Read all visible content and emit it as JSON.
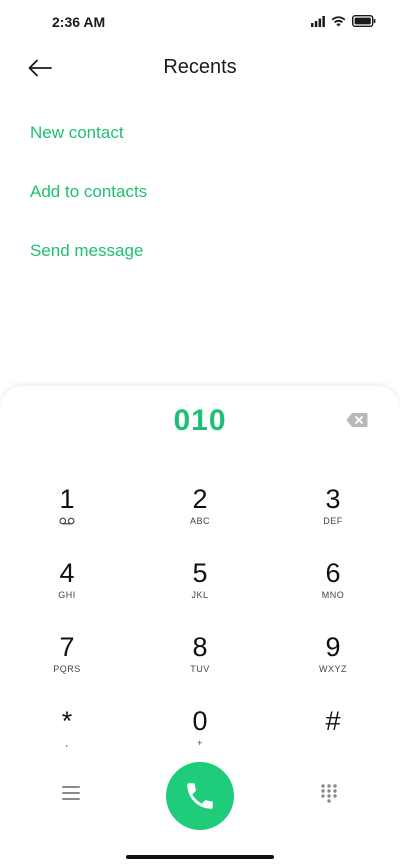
{
  "status_bar": {
    "time": "2:36 AM",
    "icons": [
      "signal-icon",
      "wifi-icon",
      "battery-icon"
    ]
  },
  "header": {
    "title": "Recents",
    "back_icon": "back-arrow-icon"
  },
  "actions": [
    {
      "label": "New contact"
    },
    {
      "label": "Add to contacts"
    },
    {
      "label": "Send message"
    }
  ],
  "dialpad": {
    "number": "010",
    "backspace_icon": "backspace-icon",
    "keys": [
      {
        "digit": "1",
        "letters": ""
      },
      {
        "digit": "2",
        "letters": "ABC"
      },
      {
        "digit": "3",
        "letters": "DEF"
      },
      {
        "digit": "4",
        "letters": "GHI"
      },
      {
        "digit": "5",
        "letters": "JKL"
      },
      {
        "digit": "6",
        "letters": "MNO"
      },
      {
        "digit": "7",
        "letters": "PQRS"
      },
      {
        "digit": "8",
        "letters": "TUV"
      },
      {
        "digit": "9",
        "letters": "WXYZ"
      },
      {
        "digit": "*",
        "letters": ","
      },
      {
        "digit": "0",
        "letters": "+"
      },
      {
        "digit": "#",
        "letters": ""
      }
    ],
    "key1_sub_icon": "voicemail-icon",
    "bottom": {
      "menu_icon": "menu-icon",
      "call_icon": "phone-icon",
      "keypad_icon": "dialpad-icon"
    }
  },
  "colors": {
    "accent": "#1fbf75",
    "call_button": "#1fcc7a"
  }
}
